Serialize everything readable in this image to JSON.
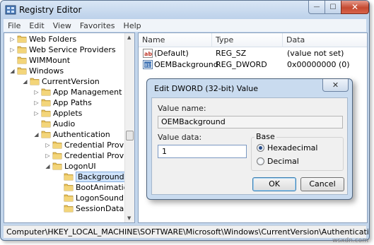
{
  "window": {
    "title": "Registry Editor",
    "close_glyph": "✕",
    "min_glyph": "—",
    "max_glyph": "☐"
  },
  "menu": [
    "File",
    "Edit",
    "View",
    "Favorites",
    "Help"
  ],
  "tree": {
    "items": [
      {
        "label": "Web Folders",
        "expander": "▷"
      },
      {
        "label": "Web Service Providers",
        "expander": "▷"
      },
      {
        "label": "WIMMount",
        "expander": ""
      },
      {
        "label": "Windows",
        "expander": "◢"
      },
      {
        "label": "CurrentVersion",
        "expander": "◢"
      },
      {
        "label": "App Management",
        "expander": "▷"
      },
      {
        "label": "App Paths",
        "expander": "▷"
      },
      {
        "label": "Applets",
        "expander": "▷"
      },
      {
        "label": "Audio",
        "expander": ""
      },
      {
        "label": "Authentication",
        "expander": "◢"
      },
      {
        "label": "Credential Provider",
        "expander": "▷"
      },
      {
        "label": "Credential Provider",
        "expander": "▷"
      },
      {
        "label": "LogonUI",
        "expander": "◢"
      },
      {
        "label": "Background",
        "expander": "",
        "selected": true
      },
      {
        "label": "BootAnimation",
        "expander": ""
      },
      {
        "label": "LogonSoundPla",
        "expander": ""
      },
      {
        "label": "SessionData",
        "expander": ""
      }
    ]
  },
  "list": {
    "columns": [
      "Name",
      "Type",
      "Data"
    ],
    "rows": [
      {
        "name": "(Default)",
        "type": "REG_SZ",
        "data": "(value not set)",
        "icon": "string-value-icon"
      },
      {
        "name": "OEMBackground",
        "type": "REG_DWORD",
        "data": "0x00000000 (0)",
        "icon": "binary-value-icon"
      }
    ]
  },
  "status": {
    "path": "Computer\\HKEY_LOCAL_MACHINE\\SOFTWARE\\Microsoft\\Windows\\CurrentVersion\\Authentication\\LogonUI"
  },
  "dialog": {
    "title": "Edit DWORD (32-bit) Value",
    "close_glyph": "✕",
    "value_name_label": "Value name:",
    "value_name": "OEMBackground",
    "value_data_label": "Value data:",
    "value_data": "1",
    "base_label": "Base",
    "base_options": [
      {
        "label": "Hexadecimal",
        "checked": true
      },
      {
        "label": "Decimal",
        "checked": false
      }
    ],
    "ok_label": "OK",
    "cancel_label": "Cancel"
  },
  "watermark": "wsxdn.com",
  "colors": {
    "window_frame": "#c3d6ec",
    "selection": "#cfe3fb",
    "folder": "#e8c15a",
    "close_button": "#c54a31"
  }
}
